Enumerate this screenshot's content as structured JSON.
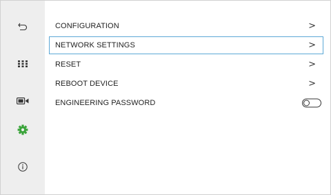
{
  "sidebar": {
    "items": [
      {
        "icon": "back-icon"
      },
      {
        "icon": "keypad-icon"
      },
      {
        "icon": "camera-icon"
      },
      {
        "icon": "settings-gear-icon",
        "active": true
      },
      {
        "icon": "info-icon"
      }
    ],
    "colors": {
      "background": "#eeeeee",
      "icon": "#333333",
      "active": "#3aa43a"
    }
  },
  "menu": {
    "items": [
      {
        "label": "CONFIGURATION",
        "indicator": ">"
      },
      {
        "label": "NETWORK SETTINGS",
        "indicator": ">",
        "selected": true
      },
      {
        "label": "RESET",
        "indicator": ">"
      },
      {
        "label": "REBOOT DEVICE",
        "indicator": ">"
      },
      {
        "label": "ENGINEERING PASSWORD",
        "toggle": false
      }
    ],
    "selection_color": "#5aa7d6"
  }
}
